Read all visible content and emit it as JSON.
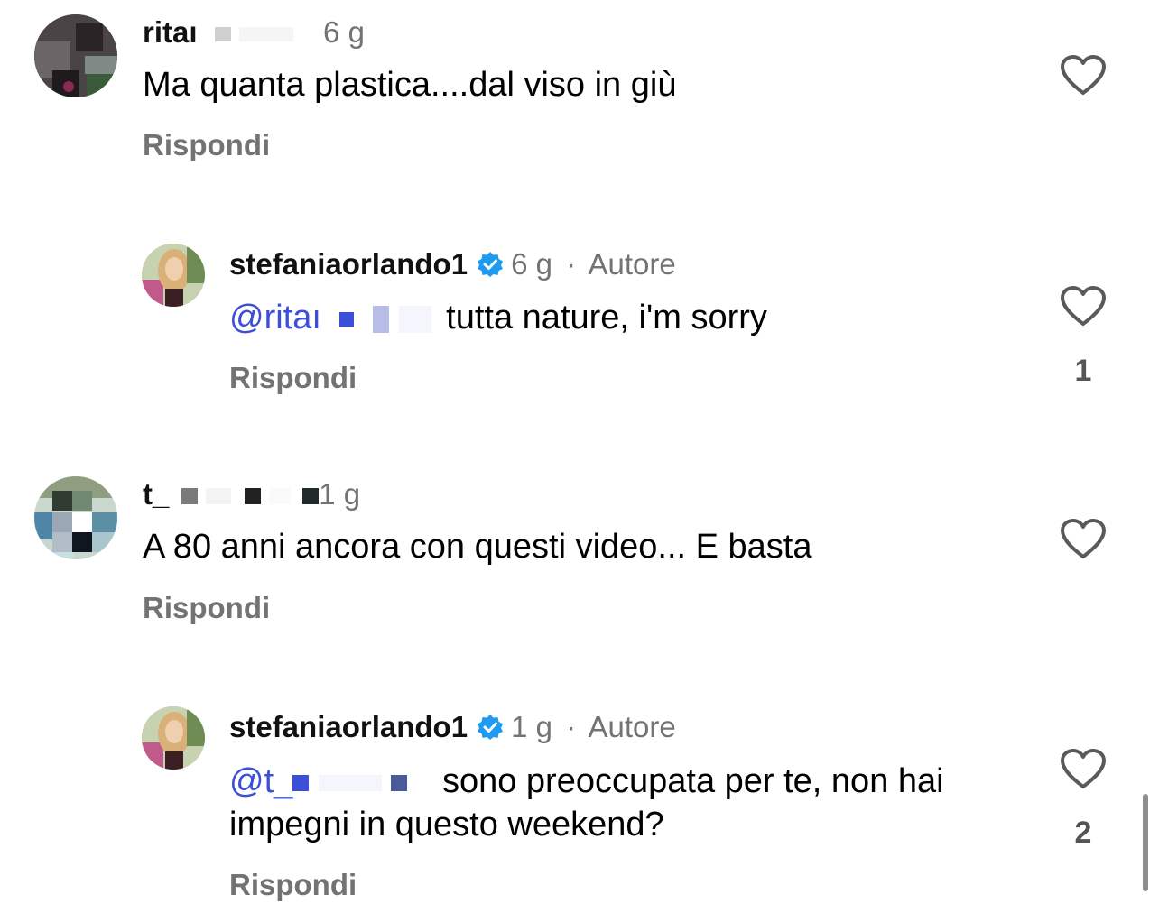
{
  "comments": [
    {
      "username": "ritaı",
      "time": "6 g",
      "text": "Ma quanta plastica....dal viso in giù",
      "reply_label": "Rispondi"
    },
    {
      "username": "stefaniaorlando1",
      "time": "6 g",
      "author_label": "Autore",
      "separator": "·",
      "mention": "@ritaı",
      "text": "tutta nature, i'm sorry",
      "reply_label": "Rispondi",
      "likes": "1"
    },
    {
      "username": "t_",
      "time": "1 g",
      "text": "A 80 anni ancora con questi video... E basta",
      "reply_label": "Rispondi"
    },
    {
      "username": "stefaniaorlando1",
      "time": "1 g",
      "author_label": "Autore",
      "separator": "·",
      "mention": "@t_",
      "text": "sono preoccupata per te, non hai impegni in questo weekend?",
      "reply_label": "Rispondi",
      "likes": "2"
    }
  ],
  "icons": {
    "heart": "heart-outline-icon",
    "verified": "verified-badge-icon"
  },
  "colors": {
    "mention": "#3b4fd9",
    "verified": "#1d9bf0",
    "secondary_text": "#737373"
  }
}
